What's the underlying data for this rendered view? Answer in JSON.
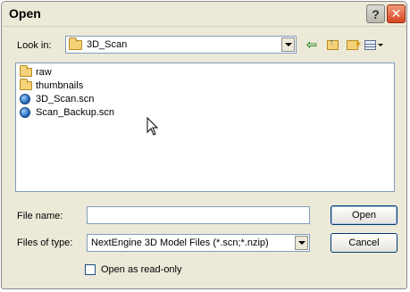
{
  "window": {
    "title": "Open"
  },
  "titlebar": {
    "help_glyph": "?",
    "close_glyph": "✕"
  },
  "toolbar": {
    "look_in_label": "Look in:",
    "look_in_value": "3D_Scan",
    "back_glyph": "⇦",
    "icons": [
      "back-icon",
      "up-folder-icon",
      "new-folder-icon",
      "views-menu-icon"
    ]
  },
  "files": [
    {
      "name": "raw",
      "type": "folder"
    },
    {
      "name": "thumbnails",
      "type": "folder"
    },
    {
      "name": "3D_Scan.scn",
      "type": "scn"
    },
    {
      "name": "Scan_Backup.scn",
      "type": "scn"
    }
  ],
  "form": {
    "file_name_label": "File name:",
    "file_name_value": "",
    "file_type_label": "Files of type:",
    "file_type_value": "NextEngine 3D Model Files (*.scn;*.nzip)",
    "read_only_label": "Open as read-only",
    "read_only_checked": false
  },
  "buttons": {
    "open_label": "Open",
    "cancel_label": "Cancel"
  },
  "colors": {
    "dialog_bg": "#ece9d8",
    "field_border": "#7f9db9",
    "close_red": "#d5451d",
    "button_border": "#003c74"
  }
}
